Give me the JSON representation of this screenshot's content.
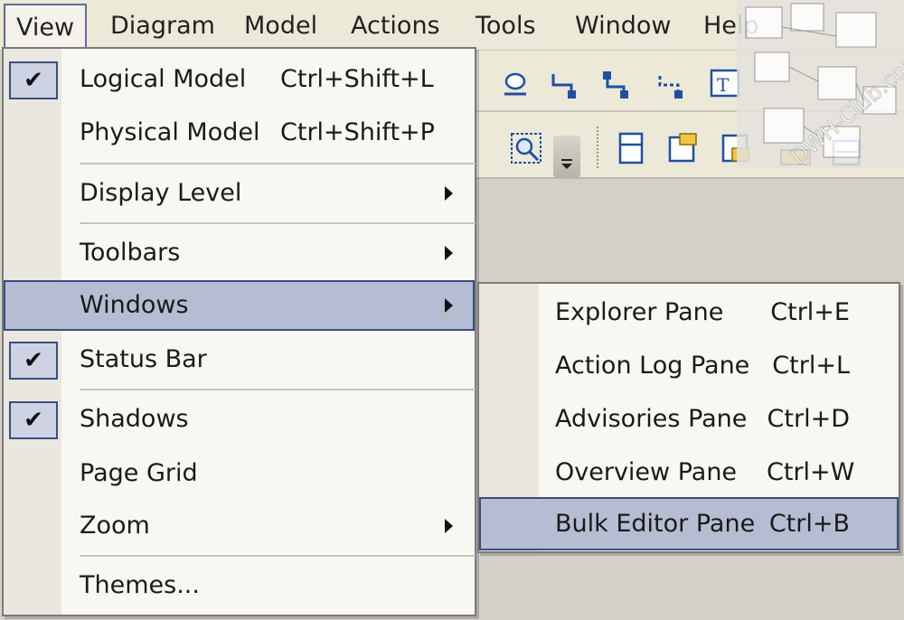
{
  "menubar": {
    "items": [
      "View",
      "Diagram",
      "Model",
      "Actions",
      "Tools",
      "Window",
      "Help"
    ],
    "open_item": "View"
  },
  "view_menu": {
    "items": [
      {
        "label": "Logical Model",
        "shortcut": "Ctrl+Shift+L",
        "checked": true
      },
      {
        "label": "Physical Model",
        "shortcut": "Ctrl+Shift+P",
        "checked": false
      },
      {
        "label": "Display Level",
        "submenu": true
      },
      {
        "label": "Toolbars",
        "submenu": true
      },
      {
        "label": "Windows",
        "submenu": true,
        "highlighted": true
      },
      {
        "label": "Status Bar",
        "checked": true
      },
      {
        "label": "Shadows",
        "checked": true
      },
      {
        "label": "Page Grid",
        "checked": false
      },
      {
        "label": "Zoom",
        "submenu": true
      },
      {
        "label": "Themes..."
      }
    ],
    "check_glyph": "✔"
  },
  "windows_submenu": {
    "items": [
      {
        "label": "Explorer Pane",
        "shortcut": "Ctrl+E"
      },
      {
        "label": "Action Log Pane",
        "shortcut": "Ctrl+L"
      },
      {
        "label": "Advisories Pane",
        "shortcut": "Ctrl+D"
      },
      {
        "label": "Overview Pane",
        "shortcut": "Ctrl+W"
      },
      {
        "label": "Bulk Editor Pane",
        "shortcut": "Ctrl+B",
        "highlighted": true
      }
    ]
  },
  "toolbar": {
    "icons": [
      "entity-icon",
      "relationship-icon",
      "identifying-relationship-icon",
      "non-identifying-relationship-icon",
      "text-block-icon",
      "zoom-to-fit-icon",
      "view-icon",
      "note-icon",
      "table-icon",
      "subject-area-icon"
    ]
  },
  "colors": {
    "highlight_fill": "#b6bdd2",
    "highlight_border": "#3a4d7f",
    "menu_bg": "#f8f7f2",
    "gutter_bg": "#e9e7df",
    "menubar_bg": "#ece9d8"
  }
}
